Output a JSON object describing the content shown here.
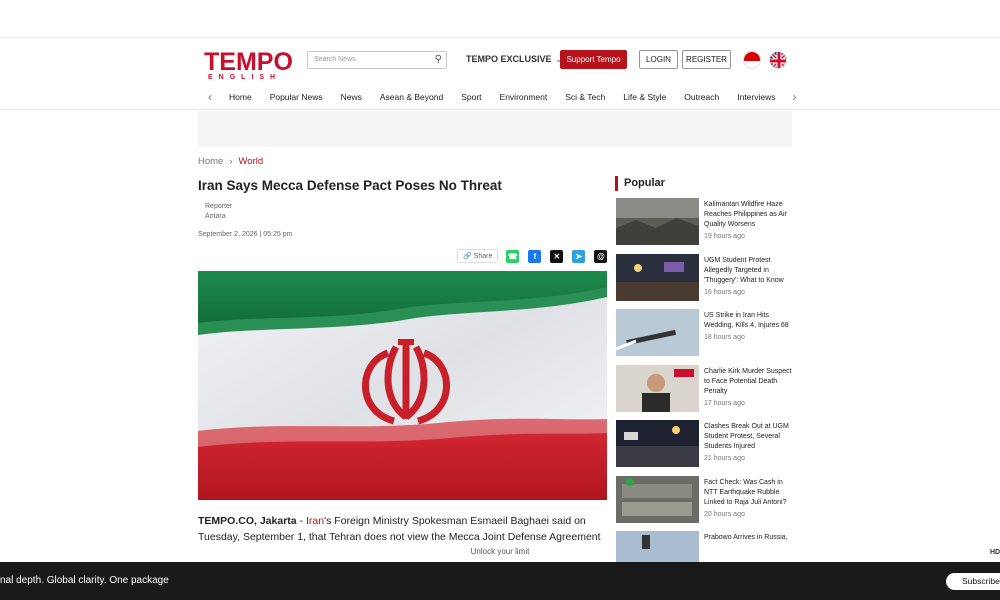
{
  "header": {
    "logo_main": "TEMPO",
    "logo_sub": "ENGLISH",
    "search_placeholder": "Search News",
    "exclusive_label": "TEMPO EXCLUSIVE",
    "support_label": "Support Tempo",
    "login_label": "LOGIN",
    "register_label": "REGISTER"
  },
  "nav": {
    "items": [
      "Home",
      "Popular News",
      "News",
      "Asean & Beyond",
      "Sport",
      "Environment",
      "Sci & Tech",
      "Life & Style",
      "Outreach",
      "Interviews"
    ]
  },
  "breadcrumb": {
    "home": "Home",
    "current": "World"
  },
  "article": {
    "title": "Iran Says Mecca Defense Pact Poses No Threat",
    "reporter_label": "Reporter",
    "reporter_name": "Antara",
    "date": "September 2, 2026 | 05:25 pm",
    "share_label": "Share",
    "dateline": "TEMPO.CO, Jakarta",
    "dash": " - ",
    "link_word": "Iran",
    "body_rest": "'s Foreign Ministry Spokesman Esmaeil Baghaei said on Tuesday, September 1, that Tehran does not view the Mecca Joint Defense Agreement"
  },
  "popular": {
    "heading": "Popular",
    "items": [
      {
        "title": "Kalimantan Wildfire Haze Reaches Philippines as Air Quality Worsens",
        "time": "19 hours ago"
      },
      {
        "title": "UGM Student Protest Allegedly Targeted in 'Thuggery': What to Know",
        "time": "16 hours ago"
      },
      {
        "title": "US Strike in Iran Hits Wedding, Kills 4, Injures 68",
        "time": "18 hours ago"
      },
      {
        "title": "Charlie Kirk Murder Suspect to Face Potential Death Penalty",
        "time": "17 hours ago"
      },
      {
        "title": "Clashes Break Out at UGM Student Protest, Several Students Injured",
        "time": "21 hours ago"
      },
      {
        "title": "Fact Check: Was Cash in NTT Earthquake Rubble Linked to Raja Juli Antoni?",
        "time": "20 hours ago"
      },
      {
        "title": "Prabowo Arrives in Russia,",
        "time": ""
      }
    ]
  },
  "paywall": {
    "unlock": "Unlock your limit",
    "hd": "HD",
    "promo": "nal depth. Global clarity. One package",
    "subscribe": "Subscribe"
  },
  "colors": {
    "brand_red": "#b5121b"
  }
}
